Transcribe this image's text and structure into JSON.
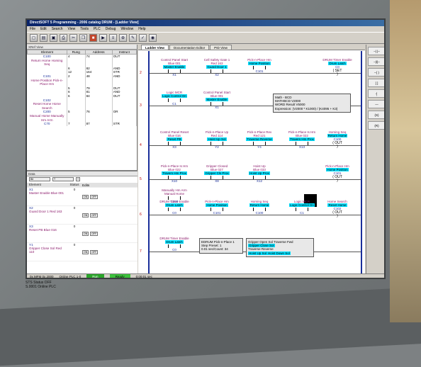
{
  "window": {
    "title": "DirectSOFT 5 Programming - 2006 catalog DRUM - [Ladder View]"
  },
  "menu": [
    "File",
    "Edit",
    "Search",
    "View",
    "Tools",
    "PLC",
    "Debug",
    "Window",
    "Help"
  ],
  "tabs": [
    "Ladder View",
    "Documentation Editor",
    "PID View"
  ],
  "left_header": "XRef View",
  "xref": {
    "headers": [
      "Element",
      "Rung",
      "Address",
      "Instruct"
    ],
    "rows": [
      {
        "el": "C100",
        "desc": "Return Home Homing Seq",
        "rung": "4",
        "addr": "74",
        "ins": "OUT"
      },
      {
        "el": "",
        "desc": "",
        "rung": "6",
        "addr": "82",
        "ins": "AND"
      },
      {
        "el": "",
        "desc": "",
        "rung": "12",
        "addr": "164",
        "ins": "STR"
      },
      {
        "el": "C101",
        "desc": "Home Position Pick-n-Place Hm",
        "rung": "2",
        "addr": "48",
        "ins": "AND"
      },
      {
        "el": "",
        "desc": "",
        "rung": "5",
        "addr": "79",
        "ins": "OUT"
      },
      {
        "el": "",
        "desc": "",
        "rung": "6",
        "addr": "81",
        "ins": "AND"
      },
      {
        "el": "",
        "desc": "",
        "rung": "6",
        "addr": "84",
        "ins": "OUT"
      },
      {
        "el": "C102",
        "desc": "Reset Home Home Search",
        "rung": "",
        "addr": "",
        "ins": ""
      },
      {
        "el": "C200",
        "desc": "Manual Home Manually Hm Arm",
        "rung": "5",
        "addr": "76",
        "ins": "OR"
      },
      {
        "el": "C70",
        "desc": "",
        "rung": "7",
        "addr": "87",
        "ins": "STR"
      }
    ]
  },
  "data_view": {
    "header": "Data",
    "select1": "Bit",
    "select2": "T",
    "headers": [
      "Element",
      "Status",
      "Edits"
    ],
    "rows": [
      {
        "el": "X1",
        "desc": "Master Enable Blue 001",
        "st": "0"
      },
      {
        "el": "X2",
        "desc": "Guard Door 1 Red 163",
        "st": "0"
      },
      {
        "el": "X3",
        "desc": "Reset PB Blue 016",
        "st": "0"
      },
      {
        "el": "Y1",
        "desc": "Gripper Close Sol Red 110",
        "st": "0"
      }
    ],
    "partial_labels": [
      "ntrol Panel Sta",
      "all Safety Gate",
      "ntrol Panel Res",
      "ck-n-Place Clos"
    ]
  },
  "rungs": [
    {
      "num": "2",
      "items": [
        {
          "t1": "Control Panel Start",
          "t2": "Blue 001",
          "t3": "Master Enable",
          "addr": "X1"
        },
        {
          "t1": "Cell Safety Gate 1",
          "t2": "Red 163",
          "t3": "Guard Door 1",
          "addr": "X2"
        },
        {
          "t1": "Pick-n-Place Hm",
          "t2": "",
          "t3": "Home Position",
          "addr": "C101"
        }
      ],
      "coil": {
        "t1": "DRUM Timer Enable",
        "t2": "Drum Latch",
        "addr": "C0",
        "op": "SET"
      }
    },
    {
      "num": "3",
      "items": [
        {
          "t1": "Logic MCR",
          "t2": "",
          "t3": "Logic Control On",
          "addr": "C1"
        },
        {
          "t1": "Control Panel Start",
          "t2": "Blue 001",
          "t3": "Master Enable",
          "addr": "X1"
        }
      ],
      "box": {
        "title": "Math - BCD",
        "name": "MATHBCD",
        "id": "V2000",
        "result": "WORD Result",
        "expr": "Expression: (V2000 * K1000) / (K4095 + K3)",
        "res_id": "V5000"
      }
    },
    {
      "num": "4",
      "items": [
        {
          "t1": "Control Panel Reset",
          "t2": "Blue 016",
          "t3": "Reset PB",
          "addr": "X3"
        },
        {
          "t1": "Pick-n-Place Up",
          "t2": "Red 114",
          "t3": "Hoist Up Sol",
          "addr": "Y2"
        },
        {
          "t1": "Pick-n-Place Rev",
          "t2": "Red 121",
          "t3": "Traverse Reverse",
          "addr": "Y4"
        },
        {
          "t1": "Pick-n-Place Is Hm",
          "t2": "Blue 022",
          "t3": "Travers Hm Prox",
          "addr": "X13"
        }
      ],
      "coil": {
        "t1": "Homing Seq",
        "t2": "Return Home",
        "addr": "C100",
        "op": "OUT"
      }
    },
    {
      "num": "5",
      "items": [
        {
          "t1": "Pick-n-Place Is Hm",
          "t2": "Blue 022",
          "t3": "Travers Hm Prox",
          "addr": "X10"
        },
        {
          "t1": "Gripper Closed",
          "t2": "Blue 027",
          "t3": "Gripper Cls Prox",
          "addr": "X8"
        },
        {
          "t1": "Hoist Up",
          "t2": "Blue 033",
          "t3": "Hoist Up Prox",
          "addr": "X12"
        }
      ],
      "coil": {
        "t1": "Pick-n-Place Hm",
        "t2": "Home Position",
        "addr": "C101",
        "op": "OUT"
      },
      "branch": {
        "t1": "Manually Hm Arm",
        "t3": "Manual Home",
        "addr": "C200"
      }
    },
    {
      "num": "6",
      "items": [
        {
          "t1": "DRUM Timer Enable",
          "t2": "",
          "t3": "Drum Latch",
          "addr": "C0"
        },
        {
          "t1": "Pick-n-Place Hm",
          "t2": "",
          "t3": "Home Position",
          "addr": "C101"
        },
        {
          "t1": "Homing Seq",
          "t2": "",
          "t3": "Return Home",
          "addr": "C100"
        },
        {
          "t1": "Logic MCR",
          "t2": "",
          "t3": "Logic Control On",
          "addr": "C1"
        }
      ],
      "coil": {
        "t1": "Home Search",
        "t2": "Reset Home",
        "addr": "C102",
        "op": "OUT"
      }
    },
    {
      "num": "7",
      "items": [
        {
          "t1": "DRUM Timer Enable",
          "t2": "",
          "t3": "Drum Latch",
          "addr": "C0"
        }
      ],
      "drum": {
        "name": "EDRUM",
        "label": "Pick-n-Place 1",
        "step_label": "Step Preset:",
        "step": "1",
        "time_label": "0.01 sec/Count:",
        "time": "34",
        "out1": "Gripper Open Sol",
        "out1b": "Gripper Close Sol",
        "out1c": "Hoist Up Sol",
        "out1d": "Hoist Down Sol",
        "out2": "Traverse Fwd",
        "out2b": "Traverse Reverse"
      }
    }
  ],
  "statusbar": {
    "left": "Run",
    "mode": "0x MFM 0x 2000",
    "ready": "Ready",
    "time": "0:00:01 sec",
    "cursor": "Online PLC 1-0"
  },
  "below": {
    "line1": "STS Status OFF",
    "line2": "S.0001 Online PLC"
  },
  "colors": {
    "highlight": "#00e0ff",
    "rail": "#1a2f9b",
    "desc": "#8b1a6b"
  }
}
